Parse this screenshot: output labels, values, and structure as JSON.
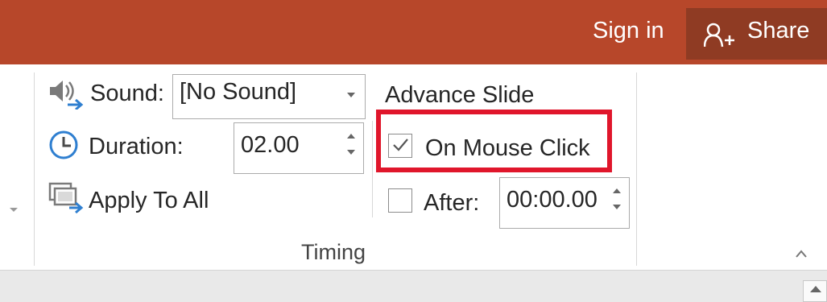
{
  "titlebar": {
    "sign_in": "Sign in",
    "share_label": "Share",
    "share_icon": "add-person-icon",
    "bg_color": "#b7472a"
  },
  "timing": {
    "sound_label": "Sound:",
    "sound_value": "[No Sound]",
    "sound_icon": "speaker-icon",
    "duration_label": "Duration:",
    "duration_value": "02.00",
    "duration_icon": "clock-icon",
    "apply_to_all_label": "Apply To All",
    "apply_to_all_icon": "apply-all-icon",
    "advance_slide_heading": "Advance Slide",
    "on_mouse_click_label": "On Mouse Click",
    "on_mouse_click_checked": true,
    "after_label": "After:",
    "after_checked": false,
    "after_value": "00:00.00",
    "group_label": "Timing",
    "highlight_color": "#e0162b"
  }
}
